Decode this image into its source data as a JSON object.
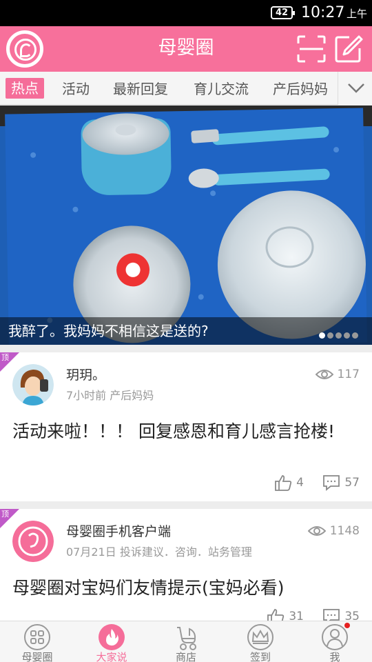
{
  "status": {
    "battery": "42",
    "time": "10:27",
    "ampm": "上午"
  },
  "header": {
    "title": "母婴圈",
    "scan_icon": "scan-icon",
    "edit_icon": "edit-icon",
    "brand_color": "#f7709b"
  },
  "tabs": [
    {
      "label": "热点",
      "active": true
    },
    {
      "label": "活动"
    },
    {
      "label": "最新回复"
    },
    {
      "label": "育儿交流"
    },
    {
      "label": "产后妈妈"
    }
  ],
  "banner": {
    "caption": "我醉了。我妈妈不相信这是送的?",
    "slide_count": 5,
    "active_slide": 1
  },
  "posts": [
    {
      "pin": "顶",
      "author": "玥玥。",
      "time": "7小时前",
      "board": "产后妈妈",
      "views": "117",
      "title": "活动来啦！！！ 回复感恩和育儿感言抢楼!",
      "likes": "4",
      "comments": "57"
    },
    {
      "pin": "顶",
      "author": "母婴圈手机客户端",
      "time": "07月21日",
      "board": "投诉建议．咨询．站务管理",
      "views": "1148",
      "title": "母婴圈对宝妈们友情提示(宝妈必看)",
      "likes": "31",
      "comments": "35"
    }
  ],
  "nav": [
    {
      "label": "母婴圈",
      "icon": "grid-icon"
    },
    {
      "label": "大家说",
      "icon": "flame-icon",
      "active": true
    },
    {
      "label": "商店",
      "icon": "stroller-icon"
    },
    {
      "label": "签到",
      "icon": "crown-icon"
    },
    {
      "label": "我",
      "icon": "person-icon"
    }
  ]
}
